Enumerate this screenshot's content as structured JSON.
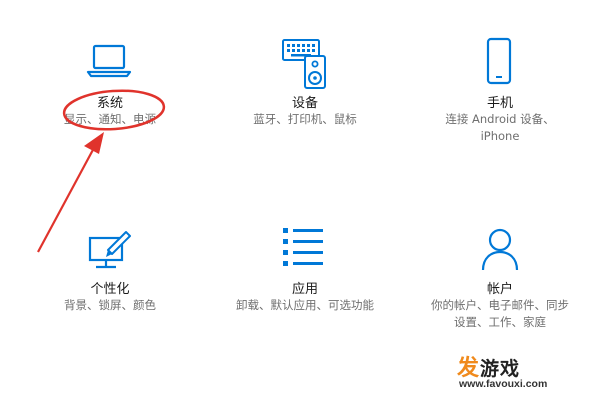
{
  "tiles": [
    {
      "title": "系统",
      "desc": [
        "显示、通知、电源"
      ],
      "icon": "laptop-icon"
    },
    {
      "title": "设备",
      "desc": [
        "蓝牙、打印机、鼠标"
      ],
      "icon": "devices-icon"
    },
    {
      "title": "手机",
      "desc": [
        "连接 Android 设备、",
        "iPhone"
      ],
      "icon": "phone-icon"
    },
    {
      "title": "个性化",
      "desc": [
        "背景、锁屏、颜色"
      ],
      "icon": "personalization-icon"
    },
    {
      "title": "应用",
      "desc": [
        "卸载、默认应用、可选功能"
      ],
      "icon": "apps-list-icon"
    },
    {
      "title": "帐户",
      "desc": [
        "你的帐户、电子邮件、同步",
        "设置、工作、家庭"
      ],
      "icon": "account-icon"
    }
  ],
  "watermark": {
    "logo_first": "发",
    "logo_rest": "游戏",
    "url": "www.favouxi.com"
  },
  "colors": {
    "accent_blue": "#0078d7",
    "annotation_red": "#e0332c",
    "watermark_orange": "#f08a1c"
  }
}
